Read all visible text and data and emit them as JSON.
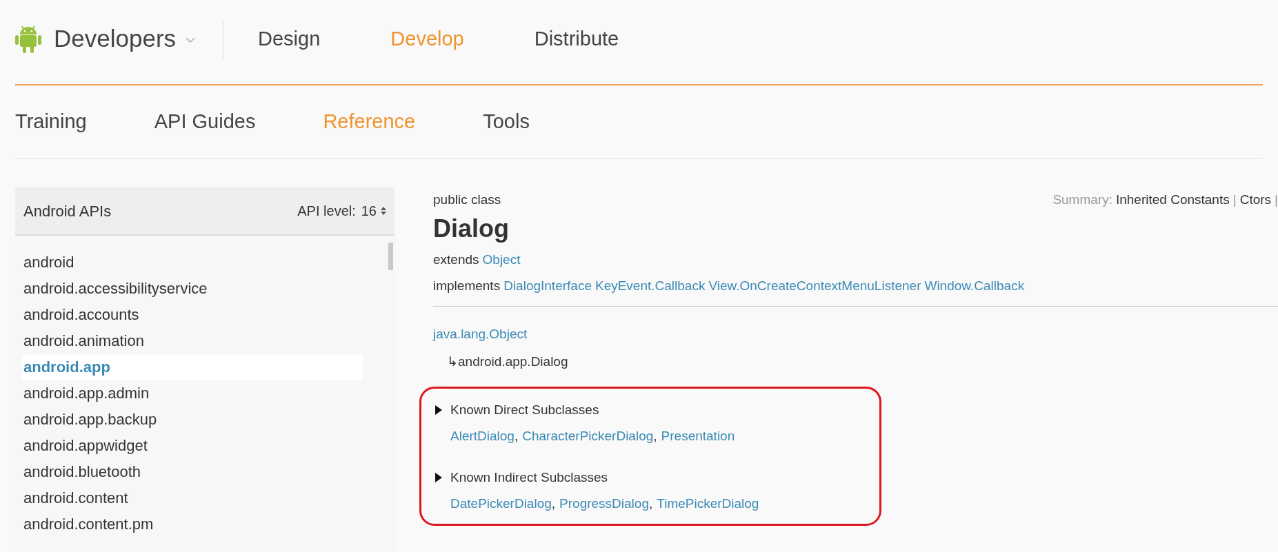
{
  "brand": {
    "name": "Developers"
  },
  "top_nav": [
    {
      "label": "Design",
      "selected": false
    },
    {
      "label": "Develop",
      "selected": true
    },
    {
      "label": "Distribute",
      "selected": false
    }
  ],
  "sub_nav": [
    {
      "label": "Training",
      "selected": false
    },
    {
      "label": "API Guides",
      "selected": false
    },
    {
      "label": "Reference",
      "selected": true
    },
    {
      "label": "Tools",
      "selected": false
    }
  ],
  "sidebar": {
    "title": "Android APIs",
    "api_level_label": "API level:",
    "api_level": "16",
    "items": [
      {
        "label": "android",
        "selected": false
      },
      {
        "label": "android.accessibilityservice",
        "selected": false
      },
      {
        "label": "android.accounts",
        "selected": false
      },
      {
        "label": "android.animation",
        "selected": false
      },
      {
        "label": "android.app",
        "selected": true
      },
      {
        "label": "android.app.admin",
        "selected": false
      },
      {
        "label": "android.app.backup",
        "selected": false
      },
      {
        "label": "android.appwidget",
        "selected": false
      },
      {
        "label": "android.bluetooth",
        "selected": false
      },
      {
        "label": "android.content",
        "selected": false
      },
      {
        "label": "android.content.pm",
        "selected": false
      }
    ]
  },
  "content": {
    "modifier": "public class",
    "class_name": "Dialog",
    "summary": {
      "label": "Summary:",
      "links": [
        "Inherited Constants",
        "Ctors"
      ],
      "separator": "|"
    },
    "extends_label": "extends",
    "extends": "Object",
    "implements_label": "implements",
    "implements": [
      "DialogInterface",
      "KeyEvent.Callback",
      "View.OnCreateContextMenuListener",
      "Window.Callback"
    ],
    "hierarchy": [
      {
        "name": "java.lang.Object",
        "kind": "link"
      },
      {
        "name": "android.app.Dialog",
        "kind": "current",
        "arrow": "↳"
      }
    ],
    "subclass_groups": [
      {
        "title": "Known Direct Subclasses",
        "separator": ",",
        "items": [
          "AlertDialog",
          "CharacterPickerDialog",
          "Presentation"
        ]
      },
      {
        "title": "Known Indirect Subclasses",
        "separator": ",",
        "items": [
          "DatePickerDialog",
          "ProgressDialog",
          "TimePickerDialog"
        ]
      }
    ]
  }
}
